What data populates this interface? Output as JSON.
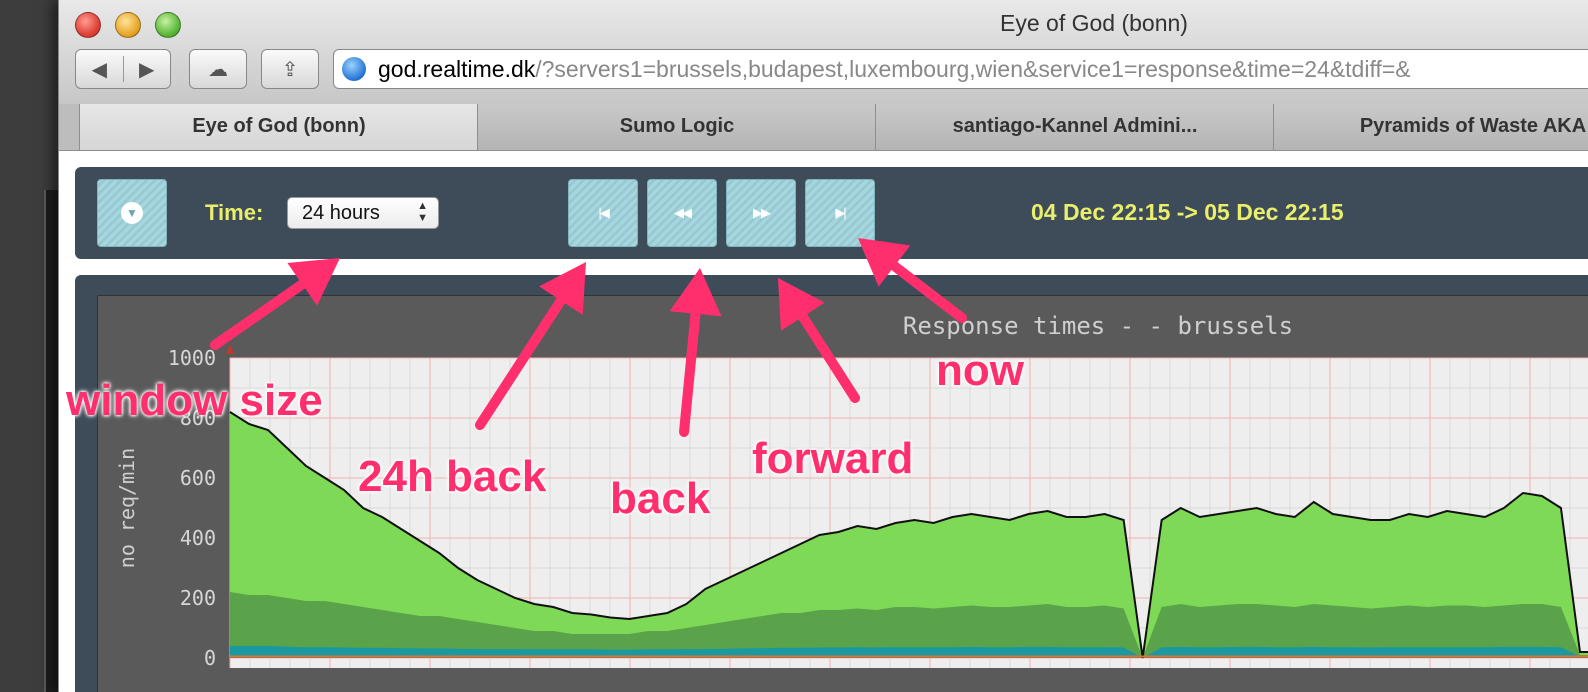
{
  "window": {
    "title": "Eye of God (bonn)",
    "url_host": "god.realtime.dk",
    "url_path": "/?servers1=brussels,budapest,luxembourg,wien&service1=response&time=24&tdiff=&"
  },
  "toolbar_icons": {
    "back": "◀",
    "forward": "▶",
    "cloud": "☁",
    "share": "⇪"
  },
  "tabs": [
    {
      "label": "Eye of God (bonn)",
      "active": true
    },
    {
      "label": "Sumo Logic",
      "active": false
    },
    {
      "label": "santiago-Kannel Admini...",
      "active": false
    },
    {
      "label": "Pyramids of Waste AKA",
      "active": false
    }
  ],
  "controls": {
    "time_label": "Time:",
    "time_value": "24 hours",
    "range_text": "04 Dec 22:15 -> 05 Dec 22:15",
    "nav_icons": [
      "first",
      "rewind",
      "fast-forward",
      "last"
    ]
  },
  "annotations": {
    "window_size": "window size",
    "back_24h": "24h back",
    "back": "back",
    "forward": "forward",
    "now": "now"
  },
  "colors": {
    "annotation": "#ff2f6e",
    "panel": "#3e4c5a",
    "accent_text": "#e9ef6b",
    "button": "#a6d7df",
    "series_total": "#7ed957",
    "series_secondary": "#5aa34a",
    "series_base": "#1a9aa0",
    "series_error": "#f06a2a"
  },
  "chart_data": {
    "type": "area",
    "title": "Response times -  - brussels",
    "ylabel": "no req/min",
    "yticks": [
      0,
      200,
      400,
      600,
      800,
      1000
    ],
    "ylim": [
      0,
      1000
    ],
    "grid": true,
    "series": [
      {
        "values": [
          820,
          780,
          760,
          700,
          640,
          600,
          560,
          500,
          470,
          430,
          390,
          350,
          300,
          260,
          230,
          200,
          180,
          170,
          150,
          145,
          135,
          130,
          140,
          150,
          180,
          230,
          260,
          290,
          320,
          350,
          380,
          410,
          420,
          440,
          430,
          450,
          460,
          450,
          470,
          480,
          470,
          460,
          480,
          490,
          470,
          470,
          480,
          460,
          0,
          460,
          500,
          470,
          480,
          490,
          500,
          480,
          470,
          520,
          480,
          470,
          460,
          460,
          480,
          470,
          490,
          480,
          470,
          500,
          550,
          540,
          500,
          20,
          20,
          30
        ]
      },
      {
        "values": [
          220,
          210,
          210,
          200,
          190,
          190,
          180,
          170,
          160,
          150,
          140,
          140,
          130,
          120,
          110,
          100,
          90,
          90,
          80,
          80,
          80,
          80,
          90,
          90,
          100,
          110,
          120,
          130,
          140,
          150,
          150,
          160,
          160,
          165,
          160,
          170,
          170,
          165,
          170,
          175,
          170,
          170,
          175,
          180,
          170,
          170,
          175,
          165,
          0,
          170,
          180,
          170,
          175,
          180,
          180,
          175,
          170,
          180,
          175,
          170,
          165,
          170,
          175,
          170,
          175,
          175,
          170,
          175,
          180,
          180,
          170,
          10,
          10,
          10
        ]
      },
      {
        "values": [
          40,
          40,
          40,
          38,
          36,
          36,
          35,
          34,
          34,
          33,
          32,
          32,
          31,
          30,
          30,
          30,
          29,
          29,
          29,
          29,
          28,
          28,
          29,
          29,
          30,
          30,
          31,
          32,
          33,
          34,
          34,
          35,
          35,
          36,
          35,
          36,
          36,
          36,
          36,
          37,
          36,
          36,
          37,
          37,
          36,
          36,
          36,
          35,
          0,
          36,
          37,
          36,
          36,
          37,
          37,
          36,
          36,
          37,
          36,
          36,
          35,
          36,
          36,
          36,
          36,
          36,
          36,
          37,
          37,
          37,
          36,
          5,
          5,
          5
        ]
      },
      {
        "values": [
          5,
          5,
          5,
          5,
          5,
          5,
          5,
          5,
          5,
          5,
          5,
          5,
          5,
          5,
          5,
          5,
          5,
          5,
          5,
          5,
          5,
          5,
          5,
          5,
          5,
          5,
          5,
          5,
          5,
          5,
          5,
          5,
          5,
          5,
          5,
          5,
          5,
          5,
          5,
          5,
          5,
          5,
          5,
          5,
          5,
          5,
          5,
          5,
          5,
          5,
          5,
          5,
          5,
          5,
          5,
          5,
          5,
          5,
          5,
          5,
          5,
          5,
          5,
          5,
          5,
          5,
          5,
          5,
          5,
          5,
          5,
          5,
          5,
          5
        ]
      }
    ]
  }
}
